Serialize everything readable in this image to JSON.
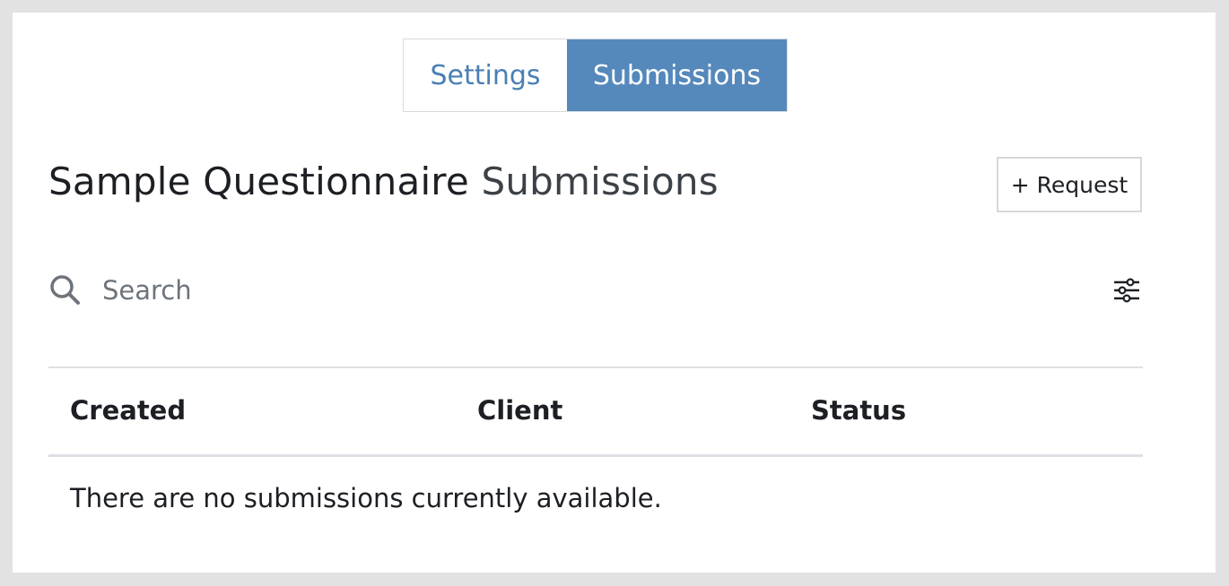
{
  "tabs": {
    "settings_label": "Settings",
    "submissions_label": "Submissions"
  },
  "header": {
    "title_strong": "Sample Questionnaire",
    "title_light": "Submissions",
    "request_button_label": "+ Request"
  },
  "search": {
    "placeholder": "Search",
    "value": ""
  },
  "table": {
    "columns": [
      "Created",
      "Client",
      "Status"
    ],
    "empty_message": "There are no submissions currently available."
  },
  "icons": {
    "search": "search-icon",
    "filter": "filter-sliders-icon"
  },
  "colors": {
    "accent": "#5588bb",
    "accent_text": "#4a7fb5",
    "background": "#e2e2e2",
    "panel": "#ffffff"
  }
}
